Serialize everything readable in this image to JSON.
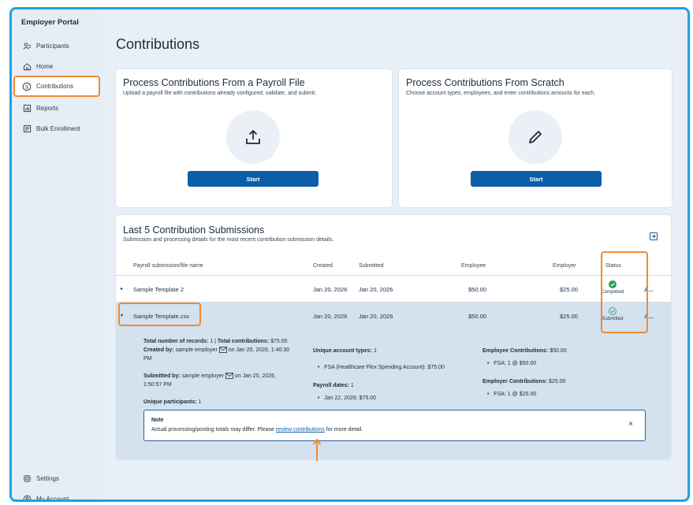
{
  "sidebar": {
    "title": "Employer Portal",
    "items": [
      {
        "label": "Participants"
      },
      {
        "label": "Home"
      },
      {
        "label": "Contributions"
      },
      {
        "label": "Reports"
      },
      {
        "label": "Bulk Enrollment"
      }
    ],
    "bottom": [
      {
        "label": "Settings"
      },
      {
        "label": "My Account"
      }
    ]
  },
  "page": {
    "title": "Contributions"
  },
  "payroll_card": {
    "title": "Process Contributions From a Payroll File",
    "subtitle": "Upload a payroll file with contributions already configured, validate, and submit.",
    "button": "Start"
  },
  "scratch_card": {
    "title": "Process Contributions From Scratch",
    "subtitle": "Choose account types, employees, and enter contributions amounts for each.",
    "button": "Start"
  },
  "submissions": {
    "title": "Last 5 Contribution Submissions",
    "subtitle": "Submission and processing details for the most recent contribution submission details.",
    "columns": [
      "Payroll submission/file name",
      "Created",
      "Submitted",
      "Employee",
      "Employer",
      "Status"
    ],
    "rows": [
      {
        "name": "Sample Template 2",
        "created": "Jan 20, 2026",
        "submitted": "Jan 20, 2026",
        "employee": "$50.00",
        "employer": "$25.00",
        "status": "Completed",
        "action": "A..."
      },
      {
        "name": "Sample Template.csv",
        "created": "Jan 20, 2026",
        "submitted": "Jan 20, 2026",
        "employee": "$50.00",
        "employer": "$25.00",
        "status": "Submitted",
        "action": "A..."
      }
    ]
  },
  "details": {
    "total_records_label": "Total number of records:",
    "total_records_value": "1",
    "total_contrib_label": "Total contributions:",
    "total_contrib_value": "$75.00",
    "created_by_label": "Created by:",
    "created_by_value": "sample employer",
    "created_on_line1": "on Jan 20, 2026, 1:40:30",
    "created_on_line2": "PM",
    "submitted_by_label": "Submitted by:",
    "submitted_by_value": "sample employer",
    "submitted_on_line1": "on Jan 20, 2026,",
    "submitted_on_line2": "1:50:57 PM",
    "unique_participants_label": "Unique participants:",
    "unique_participants_value": "1",
    "unique_account_types_label": "Unique account types:",
    "unique_account_types_value": "1",
    "account_type_item": "FSA (Healthcare Flex Spending Account): $75.00",
    "payroll_dates_label": "Payroll dates:",
    "payroll_dates_value": "1",
    "payroll_date_item": "Jan 22, 2026: $75.00",
    "employee_contrib_label": "Employee Contributions:",
    "employee_contrib_value": "$50.00",
    "employee_contrib_item": "FSA: 1 @ $50.00",
    "employer_contrib_label": "Employer Contributions:",
    "employer_contrib_value": "$25.00",
    "employer_contrib_item": "FSA: 1 @ $25.00"
  },
  "note": {
    "title": "Note",
    "text_before": "Actual processing/posting totals may differ. Please ",
    "link": "review contributions",
    "text_after": " for more detail.",
    "close": "×"
  },
  "colors": {
    "accent": "#0d5ea8",
    "highlight": "#f08a35",
    "completed": "#2e9e5b",
    "frame": "#1aa3e8"
  }
}
